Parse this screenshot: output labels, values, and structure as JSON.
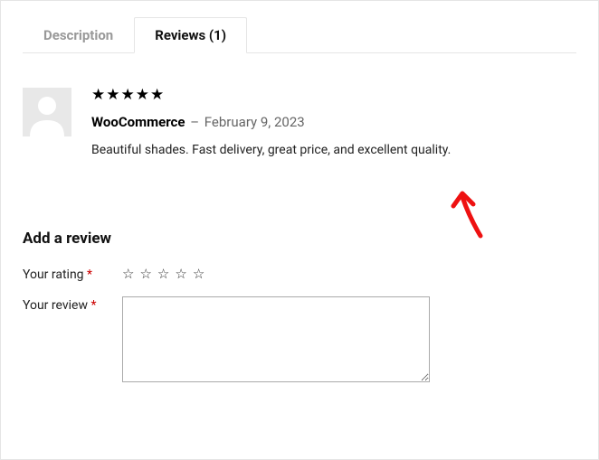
{
  "tabs": {
    "description": "Description",
    "reviews": "Reviews (1)"
  },
  "review": {
    "rating": 5,
    "author": "WooCommerce",
    "separator": "–",
    "date": "February 9, 2023",
    "text": "Beautiful shades. Fast delivery, great price, and excellent quality."
  },
  "form": {
    "title": "Add a review",
    "rating_label": "Your rating",
    "review_label": "Your review",
    "required_mark": "*"
  }
}
